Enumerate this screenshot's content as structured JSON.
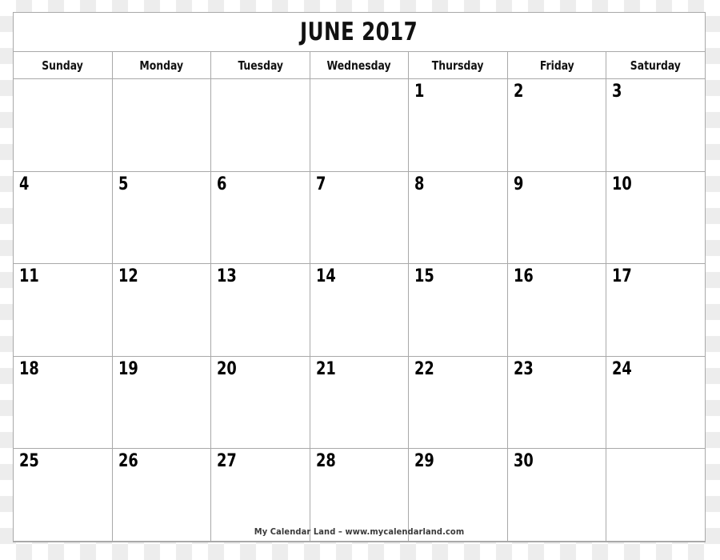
{
  "calendar": {
    "title": "JUNE 2017",
    "month": "JUNE",
    "year": "2017",
    "weekday_headers": [
      "Sunday",
      "Monday",
      "Tuesday",
      "Wednesday",
      "Thursday",
      "Friday",
      "Saturday"
    ],
    "weeks": [
      [
        "",
        "",
        "",
        "",
        "1",
        "2",
        "3"
      ],
      [
        "4",
        "5",
        "6",
        "7",
        "8",
        "9",
        "10"
      ],
      [
        "11",
        "12",
        "13",
        "14",
        "15",
        "16",
        "17"
      ],
      [
        "18",
        "19",
        "20",
        "21",
        "22",
        "23",
        "24"
      ],
      [
        "25",
        "26",
        "27",
        "28",
        "29",
        "30",
        ""
      ]
    ],
    "footer_credit": "My Calendar Land – www.mycalendarland.com",
    "colors": {
      "grid_line": "#a9a9a9",
      "text": "#111111",
      "day_number": "#000000",
      "footer_text": "#3a3a3a",
      "page_background": "#ffffff",
      "checker_light": "#ffffff",
      "checker_dark": "#ededed"
    }
  }
}
